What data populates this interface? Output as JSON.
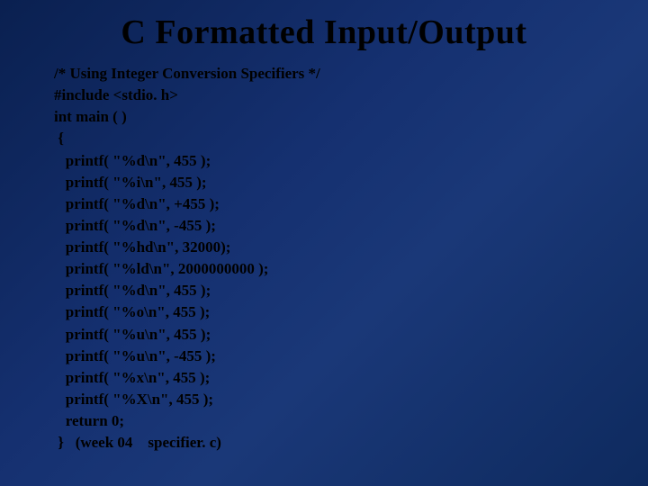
{
  "slide": {
    "title": "C Formatted Input/Output",
    "lines": [
      "/* Using Integer Conversion Specifiers */",
      "#include <stdio. h>",
      "int main ( )",
      " {",
      "   printf( \"%d\\n\", 455 );",
      "   printf( \"%i\\n\", 455 );",
      "   printf( \"%d\\n\", +455 );",
      "   printf( \"%d\\n\", -455 );",
      "   printf( \"%hd\\n\", 32000);",
      "   printf( \"%ld\\n\", 2000000000 );",
      "   printf( \"%d\\n\", 455 );",
      "   printf( \"%o\\n\", 455 );",
      "   printf( \"%u\\n\", 455 );",
      "   printf( \"%u\\n\", -455 );",
      "   printf( \"%x\\n\", 455 );",
      "   printf( \"%X\\n\", 455 );",
      "   return 0;",
      " }   (week 04    specifier. c)"
    ]
  }
}
